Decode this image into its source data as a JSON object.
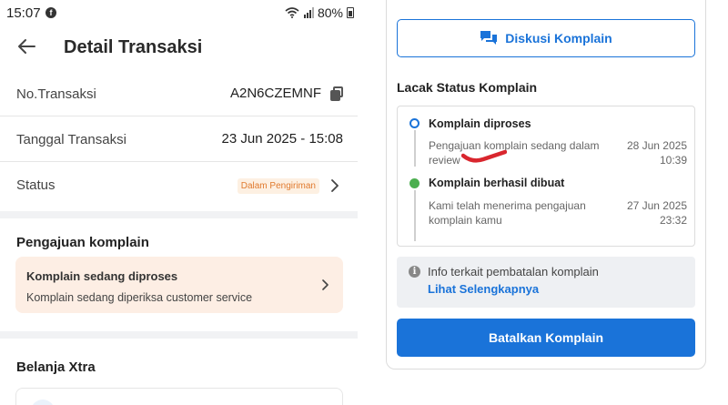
{
  "status_bar": {
    "time": "15:07",
    "battery": "80%"
  },
  "header": {
    "title": "Detail Transaksi"
  },
  "transaction": {
    "number_label": "No.Transaksi",
    "number_value": "A2N6CZEMNF",
    "date_label": "Tanggal Transaksi",
    "date_value": "23 Jun 2025 - 15:08",
    "status_label": "Status",
    "status_value": "Dalam Pengiriman"
  },
  "complaint_submission": {
    "section_title": "Pengajuan komplain",
    "card_title": "Komplain sedang diproses",
    "card_subtitle": "Komplain sedang diperiksa customer service"
  },
  "belanja_xtra": {
    "section_title": "Belanja Xtra"
  },
  "right_panel": {
    "discuss_button": "Diskusi Komplain",
    "track_title": "Lacak Status Komplain",
    "steps": [
      {
        "title": "Komplain diproses",
        "description": "Pengajuan komplain sedang dalam review",
        "date": "28 Jun 2025",
        "time": "10:39"
      },
      {
        "title": "Komplain berhasil dibuat",
        "description": "Kami telah menerima pengajuan komplain kamu",
        "date": "27 Jun 2025",
        "time": "23:32"
      }
    ],
    "info_text": "Info terkait pembatalan komplain",
    "info_link": "Lihat Selengkapnya",
    "cancel_button": "Batalkan Komplain"
  },
  "colors": {
    "primary": "#1a73d9",
    "badge_text": "#e07a2e",
    "badge_bg": "#fdf0e2",
    "card_bg": "#fdeee4",
    "step_done": "#4caf50",
    "annotation": "#d9262e"
  },
  "icons": [
    "back-arrow-icon",
    "copy-icon",
    "chevron-right-icon",
    "chat-icon",
    "info-icon",
    "wifi-icon",
    "signal-icon",
    "battery-icon",
    "facebook-icon"
  ]
}
